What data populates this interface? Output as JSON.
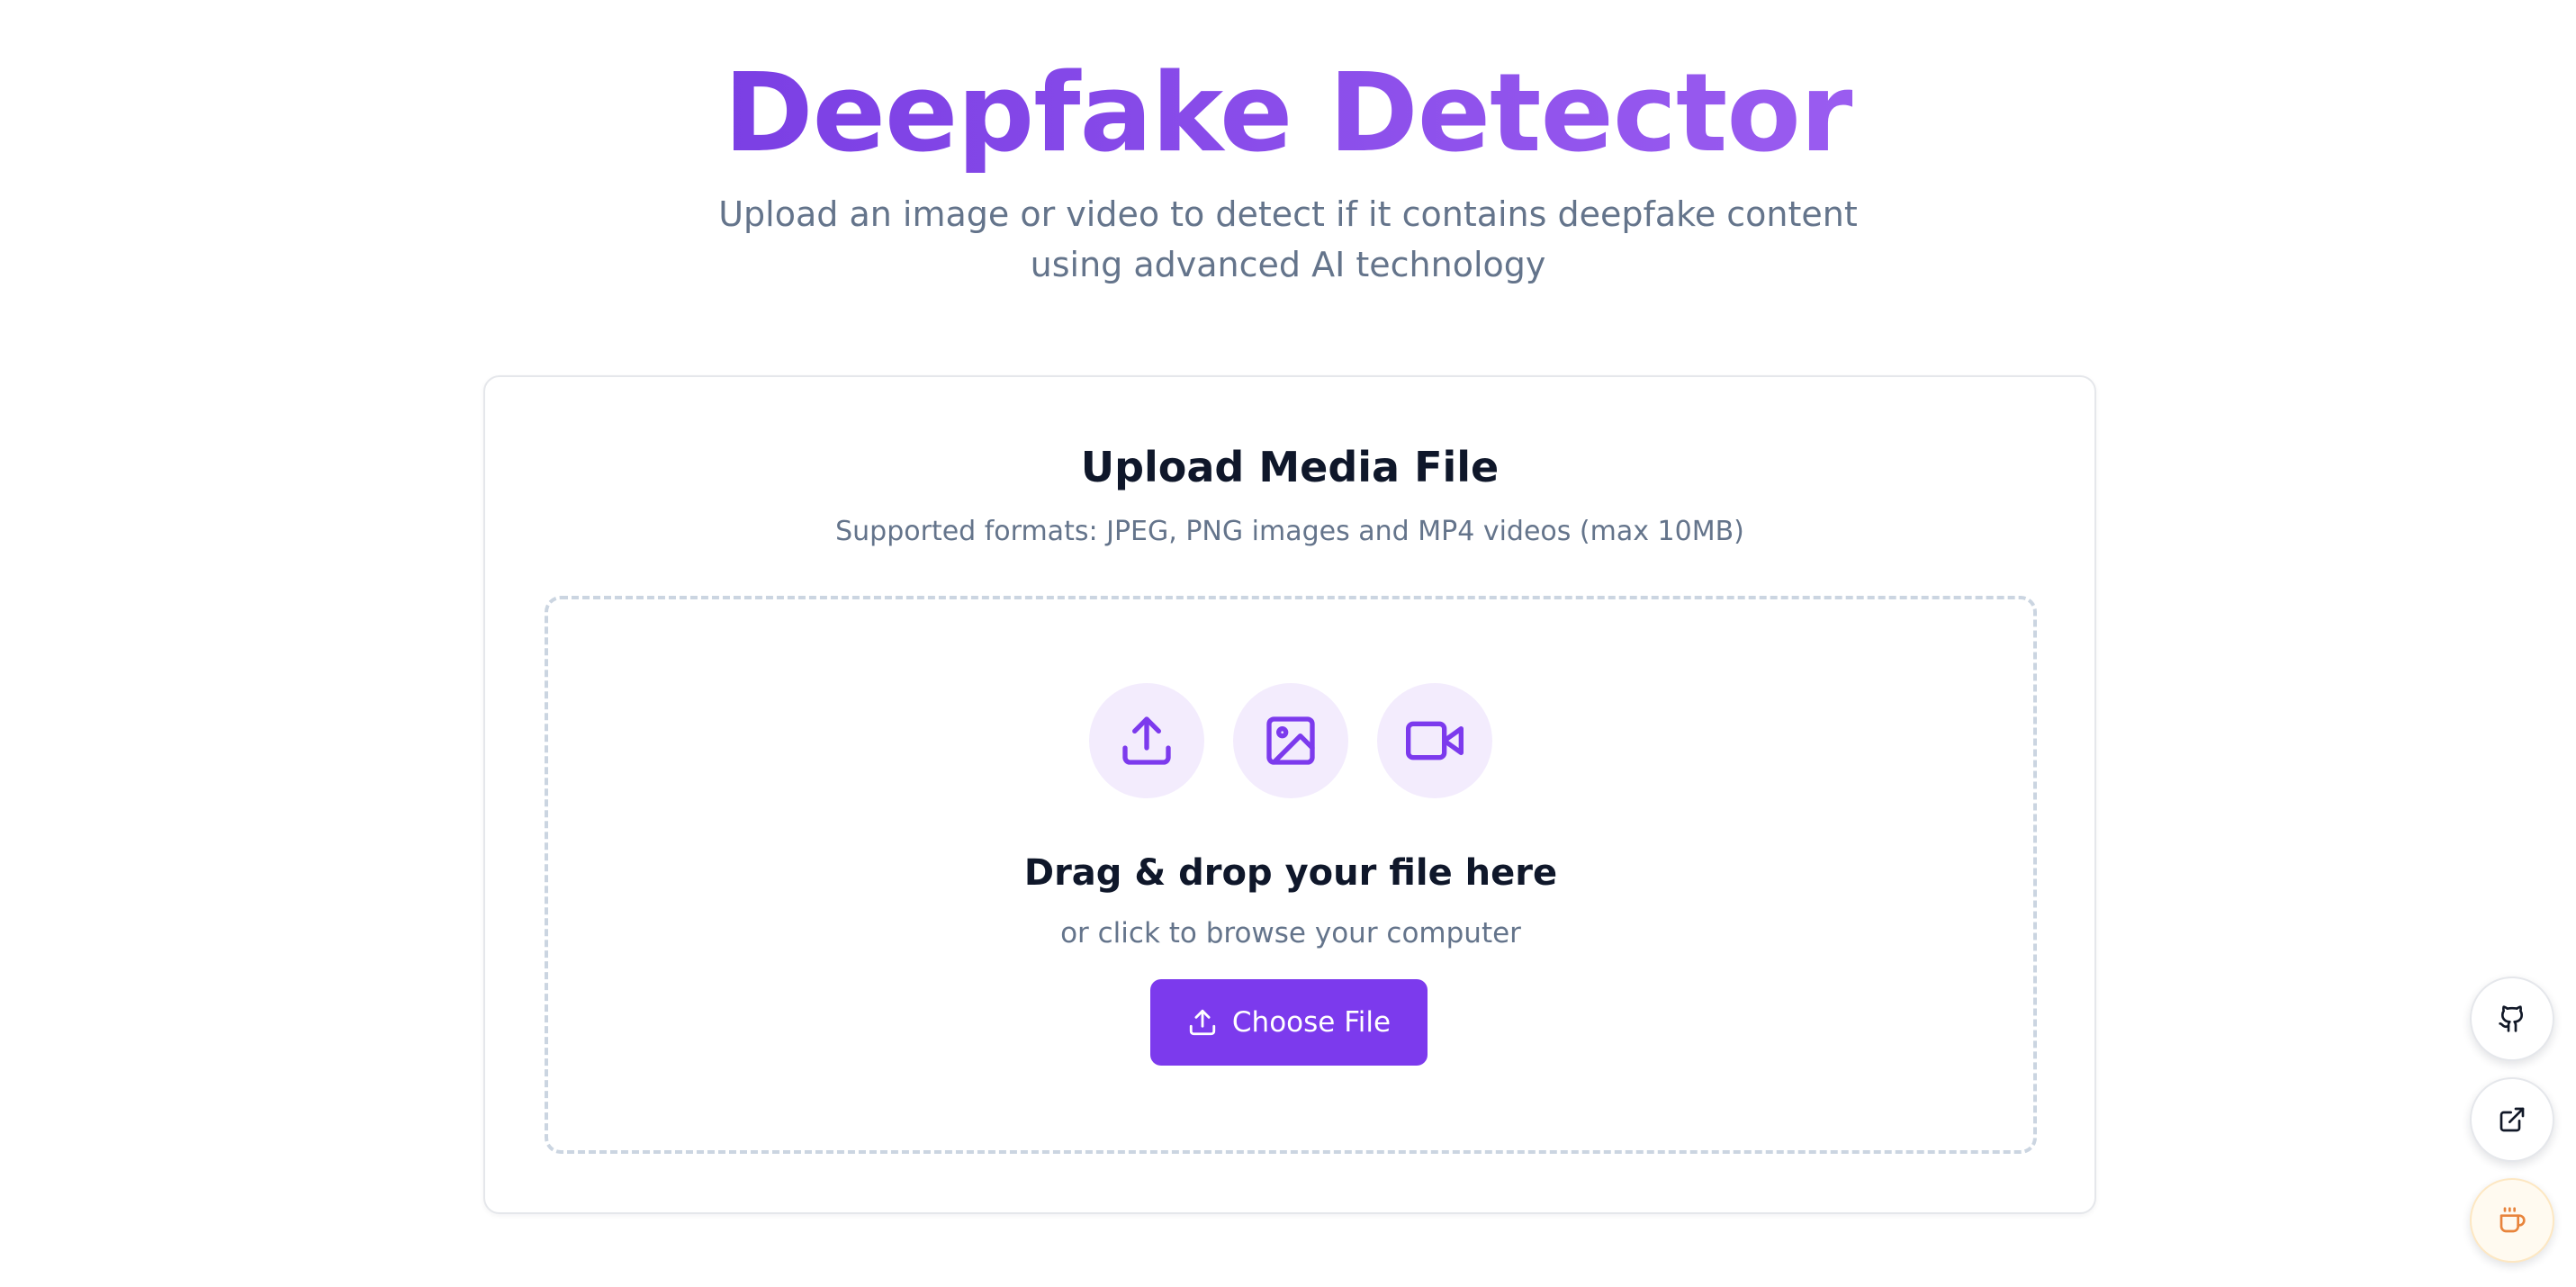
{
  "hero": {
    "title": "Deepfake Detector",
    "subtitle": "Upload an image or video to detect if it contains deepfake content using advanced AI technology"
  },
  "upload_card": {
    "title": "Upload Media File",
    "supported_formats": "Supported formats: JPEG, PNG images and MP4 videos (max 10MB)",
    "dropzone": {
      "icons": [
        "upload-icon",
        "image-icon",
        "video-icon"
      ],
      "title": "Drag & drop your file here",
      "subtitle": "or click to browse your computer",
      "button_label": "Choose File"
    }
  },
  "floating_actions": [
    {
      "icon": "github-icon"
    },
    {
      "icon": "external-link-icon"
    },
    {
      "icon": "coffee-icon"
    }
  ],
  "colors": {
    "accent": "#7c3aed",
    "accent_light": "#f3ecfd",
    "muted_text": "#64748b",
    "coffee": "#e8843c"
  }
}
